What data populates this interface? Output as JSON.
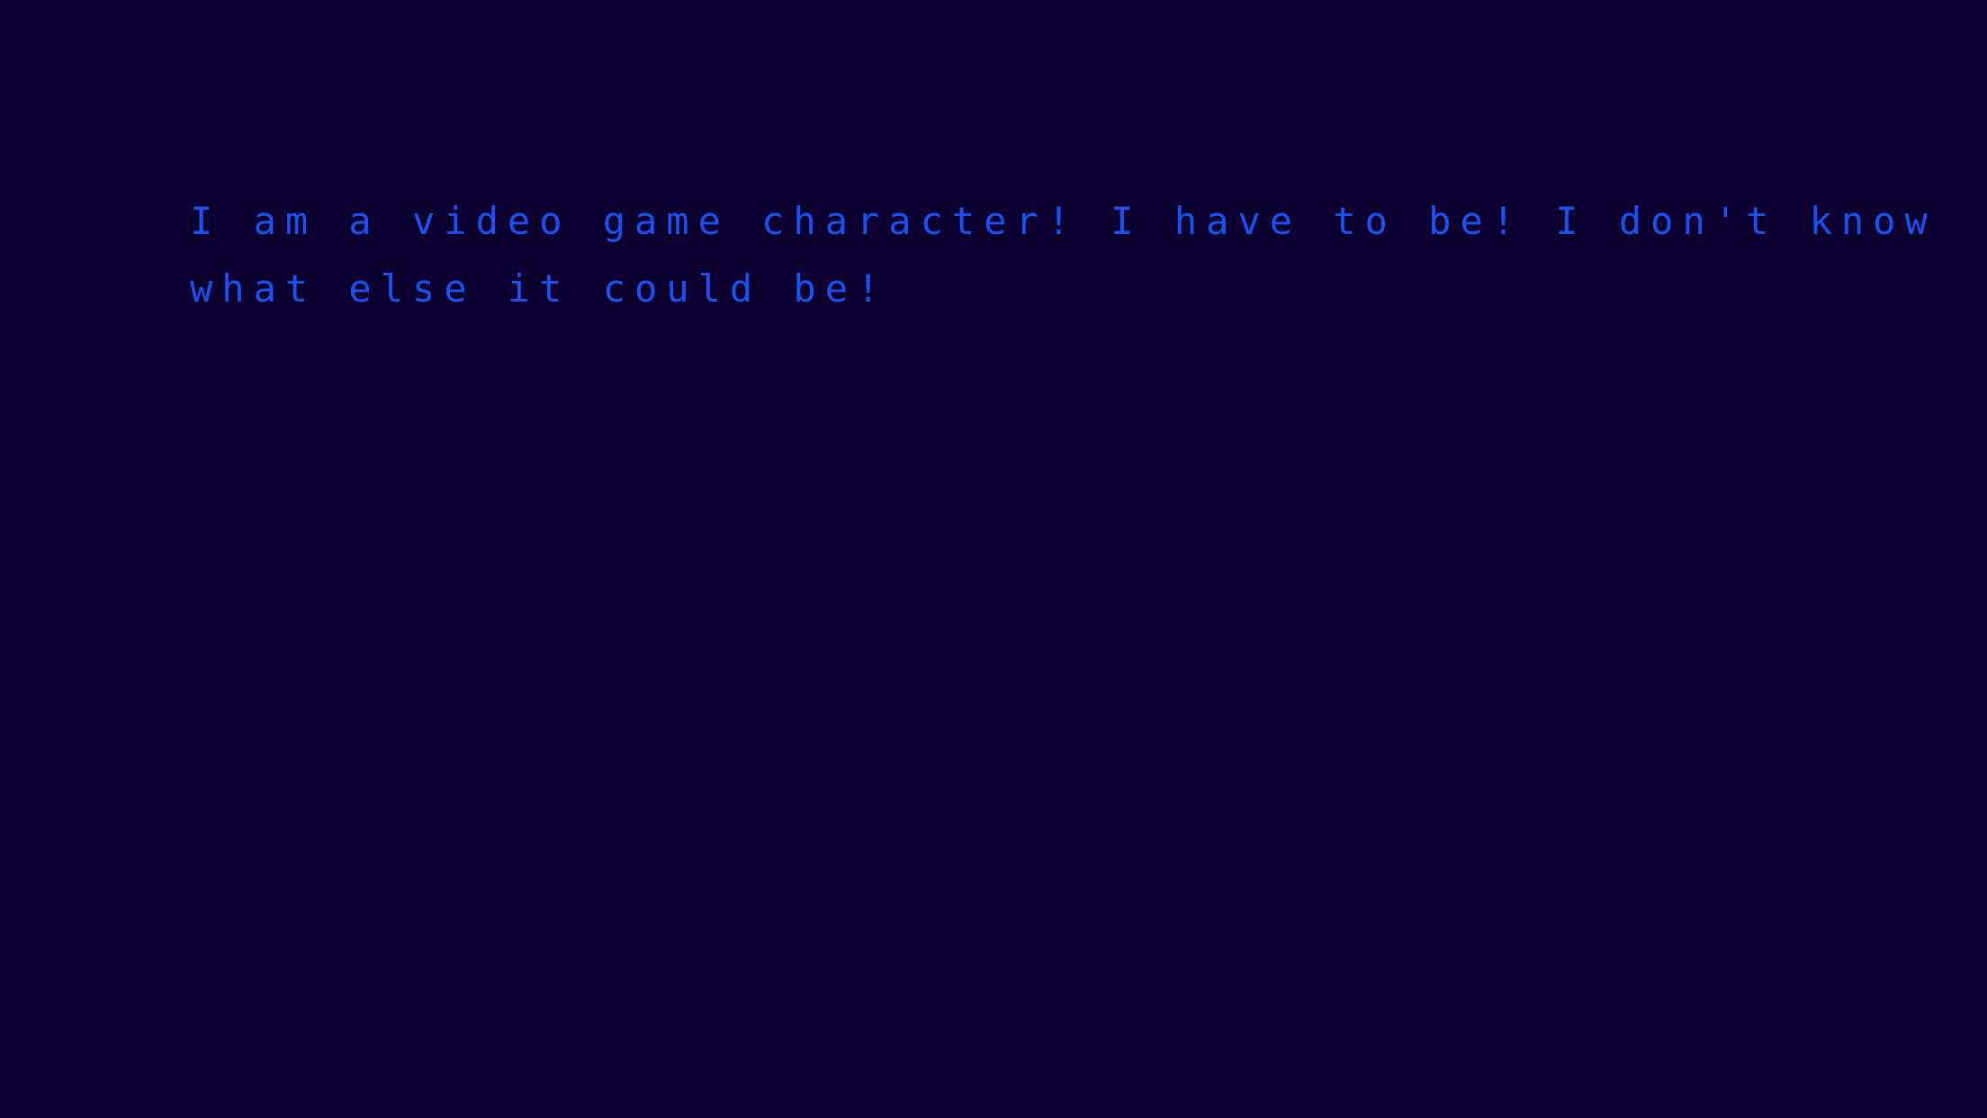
{
  "colors": {
    "background": "#0c0030",
    "text": "#1a52ee"
  },
  "dialogue": {
    "lines": [
      "I am a video game character! I have to be! I don't know",
      "what else it could be!"
    ]
  }
}
